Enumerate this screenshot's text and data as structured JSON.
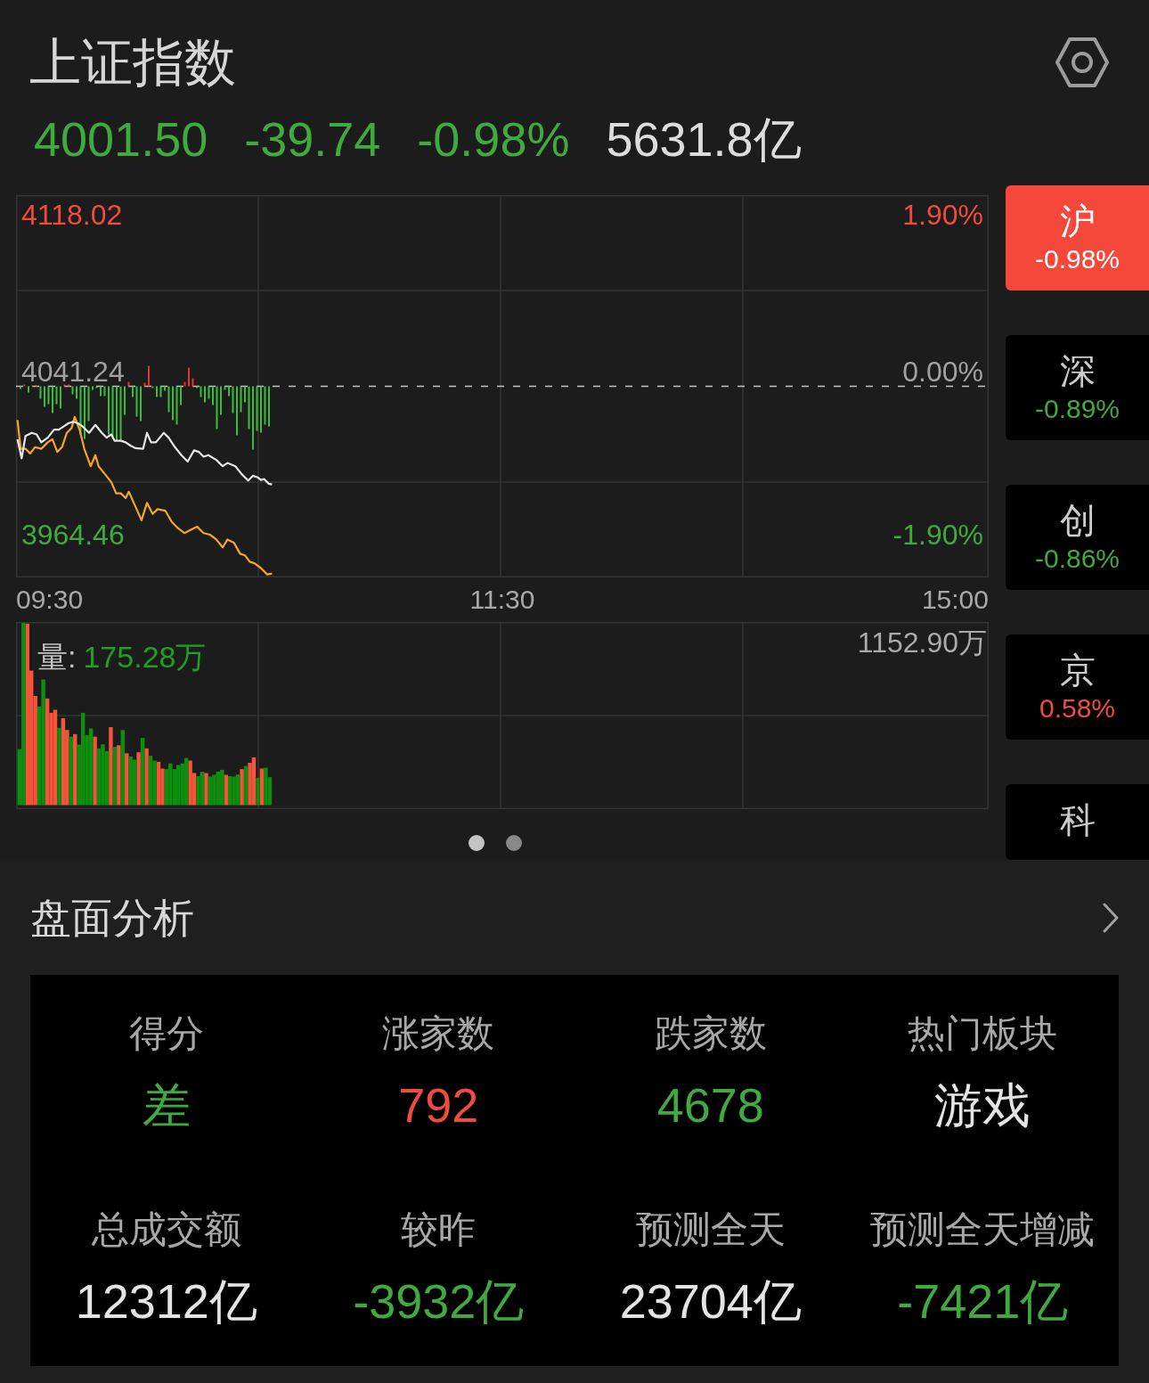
{
  "header": {
    "title": "上证指数"
  },
  "quote": {
    "price": "4001.50",
    "change": "-39.74",
    "change_pct": "-0.98%",
    "rising": false,
    "turnover": "5631.8亿"
  },
  "price_chart": {
    "price_labels": [
      "4118.02",
      "4041.24",
      "3964.46"
    ],
    "change_labels": [
      "1.90%",
      "0.00%",
      "-1.90%"
    ],
    "time_labels": [
      "09:30",
      "11:30",
      "15:00"
    ]
  },
  "volume_chart": {
    "label": "量:",
    "value": "175.28万",
    "rising": false,
    "max_label": "1152.90万"
  },
  "pager": [
    {
      "selected": true
    },
    {
      "selected": false
    }
  ],
  "market_tabs": [
    {
      "label": "沪",
      "change": "-0.98%",
      "selected": true
    },
    {
      "label": "深",
      "change": "-0.89%",
      "rising": false,
      "selected": false
    },
    {
      "label": "创",
      "change": "-0.86%",
      "rising": false,
      "selected": false
    },
    {
      "label": "京",
      "change": "0.58%",
      "rising": true,
      "selected": false
    },
    {
      "label": "科",
      "selected": false
    }
  ],
  "analysis": {
    "title": "盘面分析",
    "stats": [
      {
        "label": "得分",
        "value": "差",
        "color": "#3fab3f"
      },
      {
        "label": "涨家数",
        "value": "792",
        "color": "#f04b3c"
      },
      {
        "label": "跌家数",
        "value": "4678",
        "color": "#3fab3f"
      },
      {
        "label": "热门板块",
        "value": "游戏",
        "color": "#e4e4e4"
      },
      {
        "label": "总成交额",
        "value": "12312亿",
        "color": "#e4e4e4"
      },
      {
        "label": "较昨",
        "value": "-3932亿",
        "color": "#3fab3f"
      },
      {
        "label": "预测全天",
        "value": "23704亿",
        "color": "#e4e4e4"
      },
      {
        "label": "预测全天增减",
        "value": "-7421亿",
        "color": "#3fab3f"
      }
    ]
  }
}
